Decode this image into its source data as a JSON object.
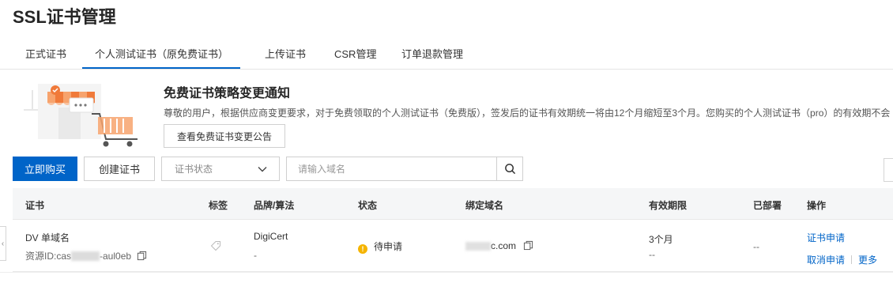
{
  "page": {
    "title": "SSL证书管理"
  },
  "tabs": [
    {
      "label": "正式证书"
    },
    {
      "label": "个人测试证书（原免费证书）",
      "active": true
    },
    {
      "label": "上传证书"
    },
    {
      "label": "CSR管理"
    },
    {
      "label": "订单退款管理"
    }
  ],
  "notice": {
    "title": "免费证书策略变更通知",
    "text": "尊敬的用户，根据供应商变更要求，对于免费领取的个人测试证书（免费版），签发后的证书有效期统一将由12个月缩短至3个月。您购买的个人测试证书（pro）的有效期不会",
    "button_label": "查看免费证书变更公告"
  },
  "toolbar": {
    "buy_label": "立即购买",
    "create_label": "创建证书",
    "status_select": {
      "placeholder": "证书状态"
    },
    "search": {
      "placeholder": "请输入域名"
    }
  },
  "table": {
    "columns": [
      "证书",
      "标签",
      "品牌/算法",
      "状态",
      "绑定域名",
      "有效期限",
      "已部署",
      "操作"
    ],
    "rows": [
      {
        "cert_type": "DV 单域名",
        "resource_prefix": "资源ID:cas",
        "resource_suffix": "-aul0eb",
        "brand": "DigiCert",
        "algorithm": "-",
        "status": "待申请",
        "domain_suffix": "c.com",
        "validity": "3个月",
        "validity_sub": "--",
        "deployed": "--",
        "actions": {
          "apply": "证书申请",
          "cancel": "取消申请",
          "more": "更多"
        }
      }
    ]
  },
  "colors": {
    "accent": "#0064c8",
    "pending": "#f5b400",
    "header_bg": "#f5f6f7"
  }
}
